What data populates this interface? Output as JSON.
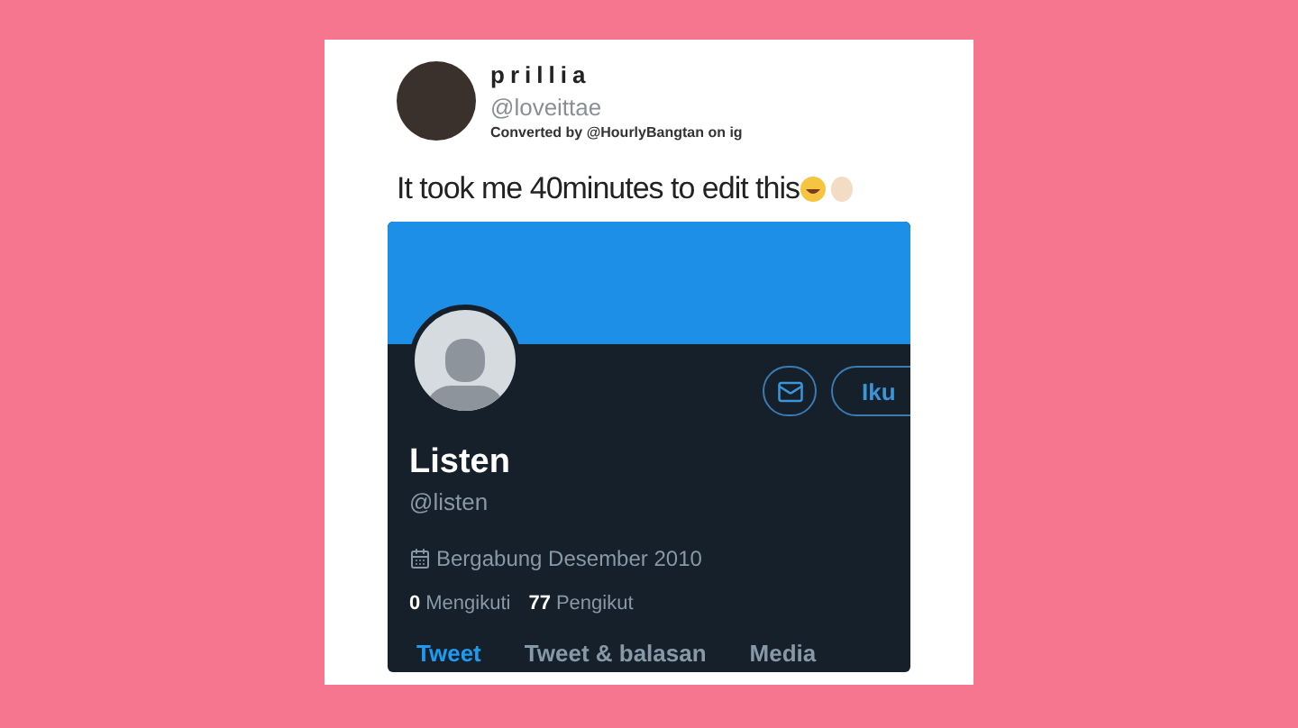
{
  "tweet": {
    "name": "prillia",
    "handle": "@loveittae",
    "credit": "Converted by @HourlyBangtan on ig",
    "text": "It took me 40minutes to edit this"
  },
  "profile": {
    "name": "Listen",
    "handle": "@listen",
    "joined": "Bergabung Desember 2010",
    "follow_button": "Iku",
    "stats": [
      {
        "count": "0",
        "label": "Mengikuti"
      },
      {
        "count": "77",
        "label": "Pengikut"
      }
    ],
    "tabs": [
      {
        "label": "Tweet",
        "selected": true
      },
      {
        "label": "Tweet & balasan",
        "selected": false
      },
      {
        "label": "Media",
        "selected": false
      }
    ]
  }
}
